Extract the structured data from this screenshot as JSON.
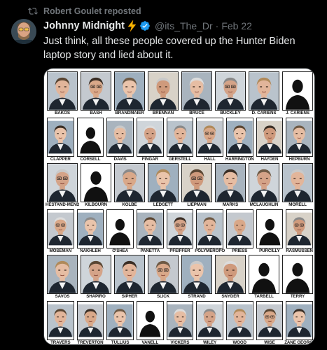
{
  "repost": {
    "label": "Robert Goulet reposted",
    "icon": "repost-icon"
  },
  "author": {
    "display_name": "Johnny Midnight",
    "handle": "@its_The_Dr",
    "separator": "·",
    "date": "Feb 22",
    "emoji_icon": "lightning-bolt-icon",
    "badge_icon": "verified-badge-icon",
    "badge_color": "#1d9bf0"
  },
  "tweet": {
    "text": "Just think, all these people covered up the Hunter Biden laptop story and lied about it."
  },
  "media": {
    "names": [
      "BAKOS",
      "BASH",
      "BRANDMAIER",
      "BRENNAN",
      "BRUCE",
      "BUCKLEY",
      "D. CARIENS",
      "J. CARIENS",
      "CLAPPER",
      "CORSELL",
      "DAVIS",
      "FINGAR",
      "GERSTELL",
      "HALL",
      "HARRINGTON",
      "HAYDEN",
      "HEPBURN",
      "HESTAND-MENDEZ",
      "KILBOURN",
      "KOLBE",
      "LEDGETT",
      "LIEPMAN",
      "MARKS",
      "MCLAUGHLIN",
      "MORELL",
      "MOSEMAN",
      "NAKHLEH",
      "O'SHEA",
      "PANETTA",
      "PFEIFFER",
      "POLYMEROPOULOS",
      "PRIESS",
      "PURCILLY",
      "RASMUSSEN",
      "SAVOS",
      "SHAPIRO",
      "SIPHER",
      "SLICK",
      "STRAND",
      "SNYDER",
      "TARBELL",
      "TERRY",
      "TRAVERS",
      "TREVERTON",
      "TULLIUS",
      "VANELL",
      "VICKERS",
      "WILEY",
      "WOOD",
      "WISE",
      "ZANE GEORGE"
    ]
  }
}
